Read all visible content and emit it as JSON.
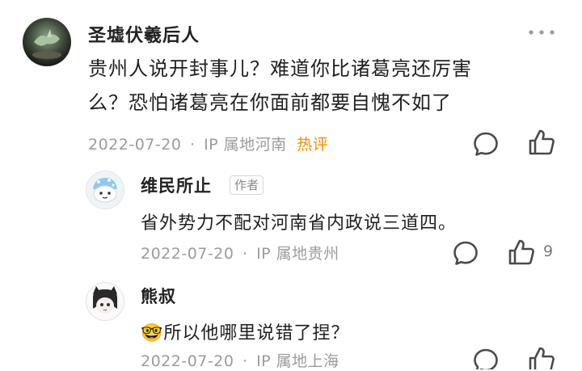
{
  "comment": {
    "author": "圣墟伏羲后人",
    "text_line1": "贵州人说开封事儿？难道你比诸葛亮还厉害",
    "text_line2": "么？恐怕诸葛亮在你面前都要自愧不如了",
    "date": "2022-07-20",
    "separator": "·",
    "ip": "IP 属地河南",
    "hot_label": "热评"
  },
  "replies": [
    {
      "author": "维民所止",
      "badge": "作者",
      "text": "省外势力不配对河南省内政说三道四。",
      "date": "2022-07-20",
      "separator": "·",
      "ip": "IP 属地贵州",
      "like_count": "9"
    },
    {
      "author": "熊叔",
      "emoji": "🤓",
      "text": "所以他哪里说错了捏？",
      "date": "2022-07-20",
      "separator": "·",
      "ip": "IP 属地上海"
    }
  ],
  "colors": {
    "hot": "#ff8a00",
    "meta": "#9b9b9b"
  },
  "icons": [
    "more-icon",
    "comment-icon",
    "like-icon"
  ]
}
